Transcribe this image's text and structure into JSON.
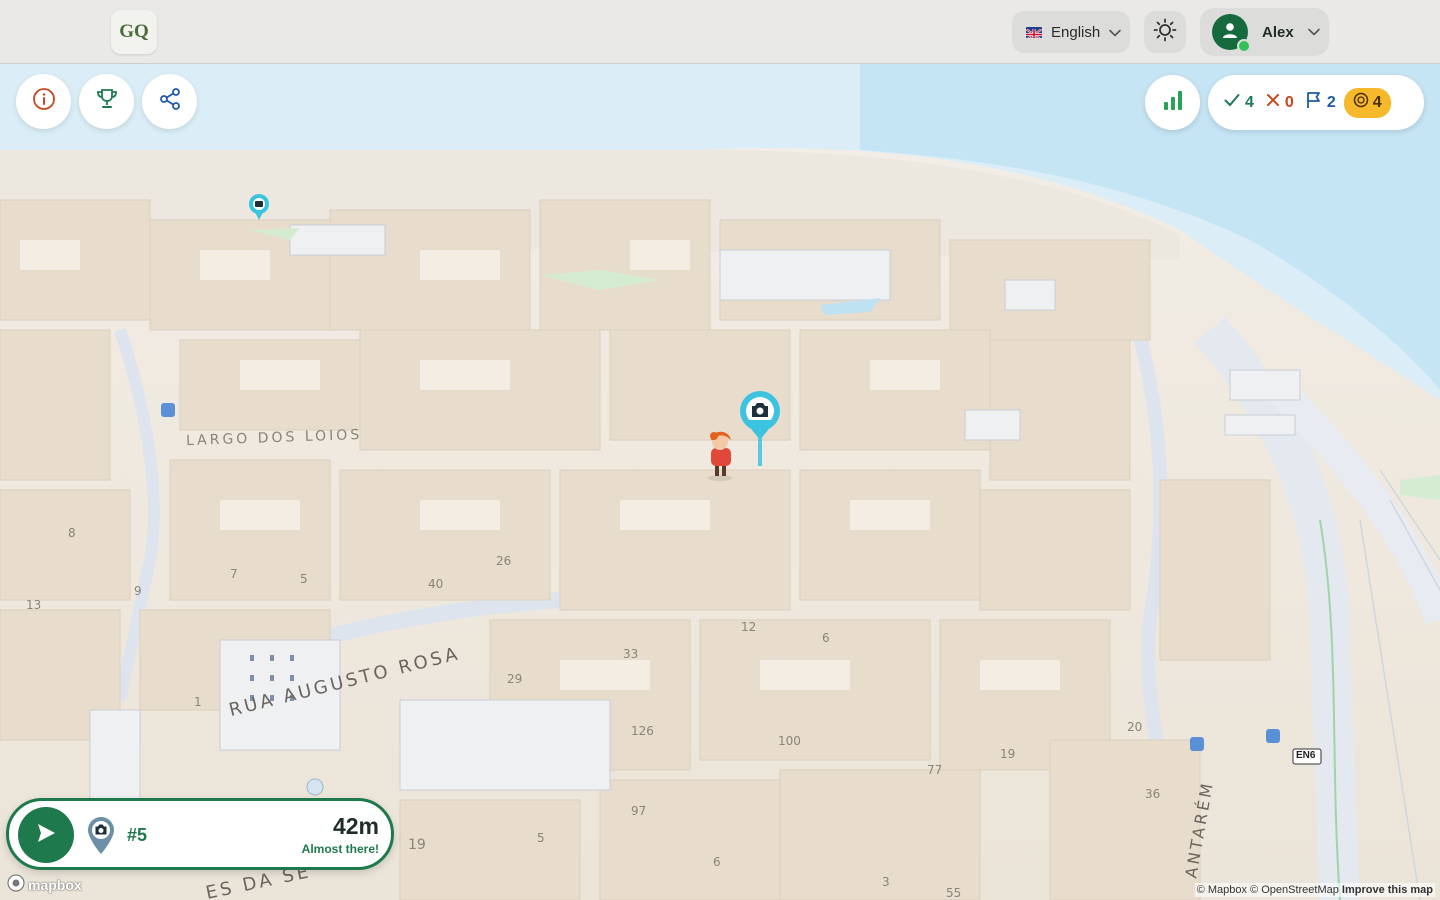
{
  "header": {
    "logo_text": "GQ",
    "language": {
      "label": "English",
      "flag": "uk-flag"
    },
    "theme_icon": "sun-icon",
    "user": {
      "name": "Alex",
      "status_color": "#32c25a"
    }
  },
  "toolbar_left": [
    {
      "name": "info-button",
      "icon": "info-icon"
    },
    {
      "name": "trophy-button",
      "icon": "trophy-icon"
    },
    {
      "name": "share-button",
      "icon": "share-icon"
    }
  ],
  "score": {
    "correct": "4",
    "wrong": "0",
    "flags": "2",
    "coins": "4"
  },
  "target_card": {
    "number": "#5",
    "distance": "42m",
    "status": "Almost there!"
  },
  "map": {
    "street_labels": [
      "LARGO DOS LOIOS",
      "RUA AUGUSTO ROSA",
      "ES DA SE",
      "ANTARÉM"
    ],
    "road_shield": "EN6",
    "house_numbers": [
      "8",
      "7",
      "5",
      "9",
      "13",
      "40",
      "26",
      "33",
      "12",
      "6",
      "29",
      "1",
      "126",
      "100",
      "97",
      "77",
      "19",
      "20",
      "36",
      "19",
      "5",
      "6",
      "3",
      "55"
    ]
  },
  "attribution": {
    "mapbox_logo": "mapbox",
    "credits": "© Mapbox © OpenStreetMap",
    "improve": "Improve this map"
  },
  "colors": {
    "accent": "#1e7a4c",
    "correct": "#1c7a5a",
    "wrong": "#c8471e",
    "flags": "#1d5ba8",
    "coin": "#f5b92b",
    "pin": "#3cc3e0",
    "water": "#cfe9f6",
    "buildings": "#e9dccb"
  }
}
